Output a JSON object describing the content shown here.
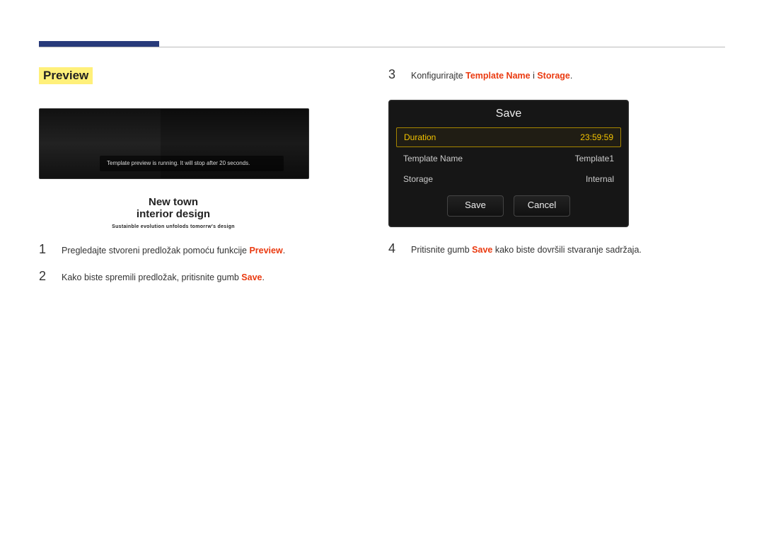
{
  "left": {
    "section_title": "Preview",
    "preview_toast": "Template preview is running. It will stop after 20 seconds.",
    "caption_line1": "New town",
    "caption_line2": "interior design",
    "caption_line3": "Sustainble evolution unfolods tomorrw's design",
    "steps": [
      {
        "num": "1",
        "pre": "Pregledajte stvoreni predložak pomoću funkcije ",
        "hl": "Preview",
        "post": "."
      },
      {
        "num": "2",
        "pre": "Kako biste spremili predložak, pritisnite gumb ",
        "hl": "Save",
        "post": "."
      }
    ]
  },
  "right": {
    "step3": {
      "num": "3",
      "pre": "Konfigurirajte ",
      "hl1": "Template Name",
      "mid": " i ",
      "hl2": "Storage",
      "post": "."
    },
    "dialog": {
      "title": "Save",
      "rows": [
        {
          "label": "Duration",
          "value": "23:59:59",
          "selected": true
        },
        {
          "label": "Template Name",
          "value": "Template1",
          "selected": false
        },
        {
          "label": "Storage",
          "value": "Internal",
          "selected": false
        }
      ],
      "save_btn": "Save",
      "cancel_btn": "Cancel"
    },
    "step4": {
      "num": "4",
      "pre": "Pritisnite gumb ",
      "hl": "Save",
      "post": " kako biste dovršili stvaranje sadržaja."
    }
  }
}
